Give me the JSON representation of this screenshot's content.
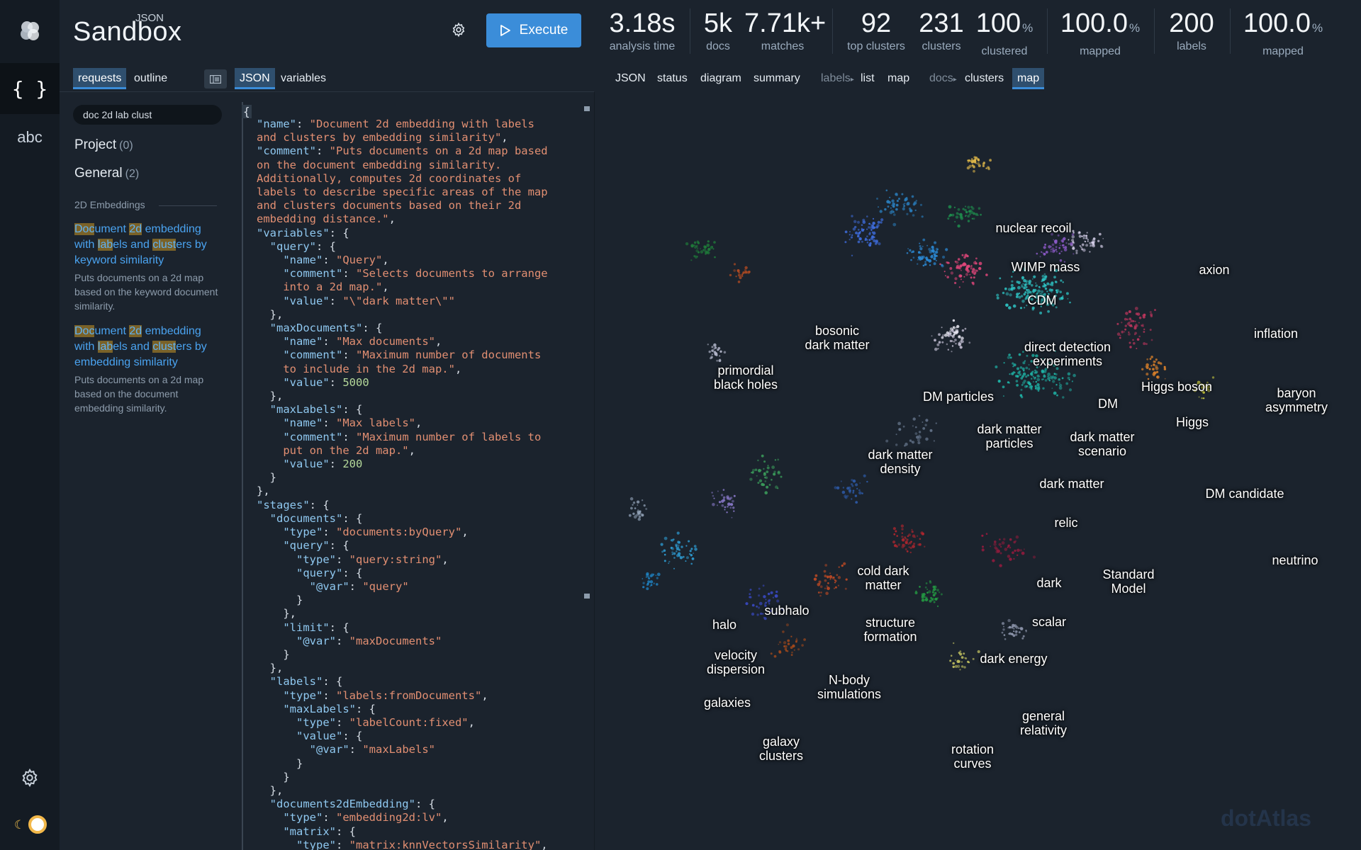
{
  "app": {
    "brand_sup": "JSON",
    "brand_name": "Sandbox",
    "execute_label": "Execute",
    "rail": {
      "abc_label": "abc"
    }
  },
  "stats": [
    {
      "value": "3.18",
      "unit": "s",
      "label": "analysis time"
    },
    {
      "value": "5k",
      "unit": "",
      "label": "docs"
    },
    {
      "value": "7.71k+",
      "unit": "",
      "label": "matches"
    },
    {
      "value": "92",
      "unit": "",
      "label": "top clusters"
    },
    {
      "value": "231",
      "unit": "",
      "label": "clusters"
    },
    {
      "value": "100",
      "unit": "%",
      "label": "clustered"
    },
    {
      "value": "100.0",
      "unit": "%",
      "label": "mapped"
    },
    {
      "value": "200",
      "unit": "",
      "label": "labels"
    },
    {
      "value": "100.0",
      "unit": "%",
      "label": "mapped"
    }
  ],
  "left_tabs": {
    "requests": "requests",
    "outline": "outline",
    "json": "JSON",
    "variables": "variables"
  },
  "right_tabs": {
    "json": "JSON",
    "status": "status",
    "diagram": "diagram",
    "summary": "summary",
    "labels_prefix": "labels",
    "labels_list": "list",
    "labels_map": "map",
    "docs_prefix": "docs",
    "docs_clusters": "clusters",
    "docs_map": "map"
  },
  "sidebar": {
    "search_value": "doc 2d lab clust",
    "groups": [
      {
        "name": "Project",
        "count": "(0)"
      },
      {
        "name": "General",
        "count": "(2)"
      }
    ],
    "section": "2D Embeddings",
    "items": [
      {
        "title_parts": [
          {
            "t": "Doc",
            "h": true
          },
          {
            "t": "ument ",
            "h": false
          },
          {
            "t": "2d",
            "h": true
          },
          {
            "t": " embedding with ",
            "h": false
          },
          {
            "t": "lab",
            "h": true
          },
          {
            "t": "els and ",
            "h": false
          },
          {
            "t": "clust",
            "h": true
          },
          {
            "t": "ers by keyword similarity",
            "h": false
          }
        ],
        "desc": "Puts documents on a 2d map based on the keyword document similarity."
      },
      {
        "title_parts": [
          {
            "t": "Doc",
            "h": true
          },
          {
            "t": "ument ",
            "h": false
          },
          {
            "t": "2d",
            "h": true
          },
          {
            "t": " embedding with ",
            "h": false
          },
          {
            "t": "lab",
            "h": true
          },
          {
            "t": "els and ",
            "h": false
          },
          {
            "t": "clust",
            "h": true
          },
          {
            "t": "ers by embedding similarity",
            "h": false
          }
        ],
        "desc": "Puts documents on a 2d map based on the document embedding similarity."
      }
    ]
  },
  "editor": {
    "first_char": "{",
    "lines": [
      [
        [
          "k",
          "\"name\""
        ],
        [
          "p",
          ": "
        ],
        [
          "s",
          "\"Document 2d embedding with labels"
        ]
      ],
      [
        [
          "s",
          "and clusters by embedding similarity\""
        ],
        [
          "p",
          ","
        ]
      ],
      [
        [
          "k",
          "\"comment\""
        ],
        [
          "p",
          ": "
        ],
        [
          "s",
          "\"Puts documents on a 2d map based"
        ]
      ],
      [
        [
          "s",
          "on the document embedding similarity."
        ]
      ],
      [
        [
          "s",
          "Additionally, computes 2d coordinates of"
        ]
      ],
      [
        [
          "s",
          "labels to describe specific areas of the map"
        ]
      ],
      [
        [
          "s",
          "and clusters documents based on their 2d"
        ]
      ],
      [
        [
          "s",
          "embedding distance.\""
        ],
        [
          "p",
          ","
        ]
      ],
      [
        [
          "k",
          "\"variables\""
        ],
        [
          "p",
          ": {"
        ]
      ],
      [
        [
          "p",
          "  "
        ],
        [
          "k",
          "\"query\""
        ],
        [
          "p",
          ": {"
        ]
      ],
      [
        [
          "p",
          "    "
        ],
        [
          "k",
          "\"name\""
        ],
        [
          "p",
          ": "
        ],
        [
          "s",
          "\"Query\""
        ],
        [
          "p",
          ","
        ]
      ],
      [
        [
          "p",
          "    "
        ],
        [
          "k",
          "\"comment\""
        ],
        [
          "p",
          ": "
        ],
        [
          "s",
          "\"Selects documents to arrange"
        ]
      ],
      [
        [
          "p",
          "    "
        ],
        [
          "s",
          "into a 2d map.\""
        ],
        [
          "p",
          ","
        ]
      ],
      [
        [
          "p",
          "    "
        ],
        [
          "k",
          "\"value\""
        ],
        [
          "p",
          ": "
        ],
        [
          "s",
          "\"\\\"dark matter\\\"\""
        ]
      ],
      [
        [
          "p",
          "  },"
        ]
      ],
      [
        [
          "p",
          "  "
        ],
        [
          "k",
          "\"maxDocuments\""
        ],
        [
          "p",
          ": {"
        ]
      ],
      [
        [
          "p",
          "    "
        ],
        [
          "k",
          "\"name\""
        ],
        [
          "p",
          ": "
        ],
        [
          "s",
          "\"Max documents\""
        ],
        [
          "p",
          ","
        ]
      ],
      [
        [
          "p",
          "    "
        ],
        [
          "k",
          "\"comment\""
        ],
        [
          "p",
          ": "
        ],
        [
          "s",
          "\"Maximum number of documents"
        ]
      ],
      [
        [
          "p",
          "    "
        ],
        [
          "s",
          "to include in the 2d map.\""
        ],
        [
          "p",
          ","
        ]
      ],
      [
        [
          "p",
          "    "
        ],
        [
          "k",
          "\"value\""
        ],
        [
          "p",
          ": "
        ],
        [
          "n",
          "5000"
        ]
      ],
      [
        [
          "p",
          "  },"
        ]
      ],
      [
        [
          "p",
          "  "
        ],
        [
          "k",
          "\"maxLabels\""
        ],
        [
          "p",
          ": {"
        ]
      ],
      [
        [
          "p",
          "    "
        ],
        [
          "k",
          "\"name\""
        ],
        [
          "p",
          ": "
        ],
        [
          "s",
          "\"Max labels\""
        ],
        [
          "p",
          ","
        ]
      ],
      [
        [
          "p",
          "    "
        ],
        [
          "k",
          "\"comment\""
        ],
        [
          "p",
          ": "
        ],
        [
          "s",
          "\"Maximum number of labels to"
        ]
      ],
      [
        [
          "p",
          "    "
        ],
        [
          "s",
          "put on the 2d map.\""
        ],
        [
          "p",
          ","
        ]
      ],
      [
        [
          "p",
          "    "
        ],
        [
          "k",
          "\"value\""
        ],
        [
          "p",
          ": "
        ],
        [
          "n",
          "200"
        ]
      ],
      [
        [
          "p",
          "  }"
        ]
      ],
      [
        [
          "p",
          "},"
        ]
      ],
      [
        [
          "k",
          "\"stages\""
        ],
        [
          "p",
          ": {"
        ]
      ],
      [
        [
          "p",
          "  "
        ],
        [
          "k",
          "\"documents\""
        ],
        [
          "p",
          ": {"
        ]
      ],
      [
        [
          "p",
          "    "
        ],
        [
          "k",
          "\"type\""
        ],
        [
          "p",
          ": "
        ],
        [
          "s",
          "\"documents:byQuery\""
        ],
        [
          "p",
          ","
        ]
      ],
      [
        [
          "p",
          "    "
        ],
        [
          "k",
          "\"query\""
        ],
        [
          "p",
          ": {"
        ]
      ],
      [
        [
          "p",
          "      "
        ],
        [
          "k",
          "\"type\""
        ],
        [
          "p",
          ": "
        ],
        [
          "s",
          "\"query:string\""
        ],
        [
          "p",
          ","
        ]
      ],
      [
        [
          "p",
          "      "
        ],
        [
          "k",
          "\"query\""
        ],
        [
          "p",
          ": {"
        ]
      ],
      [
        [
          "p",
          "        "
        ],
        [
          "k",
          "\"@var\""
        ],
        [
          "p",
          ": "
        ],
        [
          "s",
          "\"query\""
        ]
      ],
      [
        [
          "p",
          "      }"
        ]
      ],
      [
        [
          "p",
          "    },"
        ]
      ],
      [
        [
          "p",
          "    "
        ],
        [
          "k",
          "\"limit\""
        ],
        [
          "p",
          ": {"
        ]
      ],
      [
        [
          "p",
          "      "
        ],
        [
          "k",
          "\"@var\""
        ],
        [
          "p",
          ": "
        ],
        [
          "s",
          "\"maxDocuments\""
        ]
      ],
      [
        [
          "p",
          "    }"
        ]
      ],
      [
        [
          "p",
          "  },"
        ]
      ],
      [
        [
          "p",
          "  "
        ],
        [
          "k",
          "\"labels\""
        ],
        [
          "p",
          ": {"
        ]
      ],
      [
        [
          "p",
          "    "
        ],
        [
          "k",
          "\"type\""
        ],
        [
          "p",
          ": "
        ],
        [
          "s",
          "\"labels:fromDocuments\""
        ],
        [
          "p",
          ","
        ]
      ],
      [
        [
          "p",
          "    "
        ],
        [
          "k",
          "\"maxLabels\""
        ],
        [
          "p",
          ": {"
        ]
      ],
      [
        [
          "p",
          "      "
        ],
        [
          "k",
          "\"type\""
        ],
        [
          "p",
          ": "
        ],
        [
          "s",
          "\"labelCount:fixed\""
        ],
        [
          "p",
          ","
        ]
      ],
      [
        [
          "p",
          "      "
        ],
        [
          "k",
          "\"value\""
        ],
        [
          "p",
          ": {"
        ]
      ],
      [
        [
          "p",
          "        "
        ],
        [
          "k",
          "\"@var\""
        ],
        [
          "p",
          ": "
        ],
        [
          "s",
          "\"maxLabels\""
        ]
      ],
      [
        [
          "p",
          "      }"
        ]
      ],
      [
        [
          "p",
          "    }"
        ]
      ],
      [
        [
          "p",
          "  },"
        ]
      ],
      [
        [
          "p",
          "  "
        ],
        [
          "k",
          "\"documents2dEmbedding\""
        ],
        [
          "p",
          ": {"
        ]
      ],
      [
        [
          "p",
          "    "
        ],
        [
          "k",
          "\"type\""
        ],
        [
          "p",
          ": "
        ],
        [
          "s",
          "\"embedding2d:lv\""
        ],
        [
          "p",
          ","
        ]
      ],
      [
        [
          "p",
          "    "
        ],
        [
          "k",
          "\"matrix\""
        ],
        [
          "p",
          ": {"
        ]
      ],
      [
        [
          "p",
          "      "
        ],
        [
          "k",
          "\"type\""
        ],
        [
          "p",
          ": "
        ],
        [
          "s",
          "\"matrix:knnVectorsSimilarity\""
        ],
        [
          "p",
          ","
        ]
      ]
    ]
  },
  "map": {
    "labels": [
      {
        "text": "nuclear recoil"
      },
      {
        "text": "WIMP mass"
      },
      {
        "text": "axion"
      },
      {
        "text": "CDM"
      },
      {
        "text": "bosonic\ndark matter"
      },
      {
        "text": "inflation"
      },
      {
        "text": "direct detection\nexperiments"
      },
      {
        "text": "primordial\nblack holes"
      },
      {
        "text": "Higgs boson"
      },
      {
        "text": "baryon\nasymmetry"
      },
      {
        "text": "DM particles"
      },
      {
        "text": "DM"
      },
      {
        "text": "Higgs"
      },
      {
        "text": "dark matter\nparticles"
      },
      {
        "text": "dark matter\nscenario"
      },
      {
        "text": "dark matter\ndensity"
      },
      {
        "text": "dark matter"
      },
      {
        "text": "DM candidate"
      },
      {
        "text": "relic"
      },
      {
        "text": "neutrino"
      },
      {
        "text": "cold dark\nmatter"
      },
      {
        "text": "Standard\nModel"
      },
      {
        "text": "dark"
      },
      {
        "text": "subhalo"
      },
      {
        "text": "halo"
      },
      {
        "text": "scalar"
      },
      {
        "text": "structure\nformation"
      },
      {
        "text": "velocity\ndispersion"
      },
      {
        "text": "dark energy"
      },
      {
        "text": "N-body\nsimulations"
      },
      {
        "text": "galaxies"
      },
      {
        "text": "general\nrelativity"
      },
      {
        "text": "galaxy\nclusters"
      },
      {
        "text": "rotation\ncurves"
      }
    ],
    "watermark": "dotAtlas"
  }
}
